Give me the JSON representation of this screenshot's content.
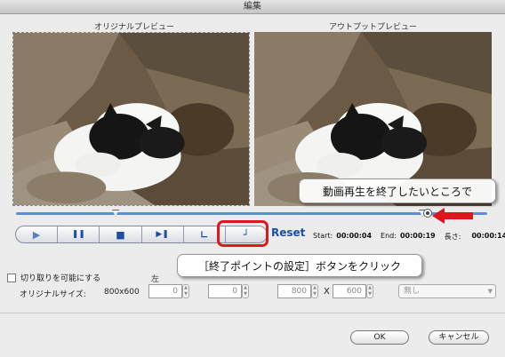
{
  "window": {
    "title": "編集"
  },
  "previews": {
    "original_label": "オリジナルプレビュー",
    "output_label": "アウトプットプレビュー"
  },
  "controls": {
    "buttons": [
      {
        "name": "play-button",
        "glyph": "▶"
      },
      {
        "name": "pause-button",
        "glyph": "❚❚"
      },
      {
        "name": "stop-button",
        "glyph": "■"
      },
      {
        "name": "next-frame-button",
        "glyph": "▶❚"
      },
      {
        "name": "set-start-point-button",
        "glyph": "∟"
      },
      {
        "name": "set-end-point-button",
        "glyph": "┘"
      }
    ],
    "reset_label": "Reset"
  },
  "times": {
    "start_label": "Start:",
    "start_value": "00:00:04",
    "end_label": "End:",
    "end_value": "00:00:19",
    "length_label": "長さ:",
    "length_value": "00:00:14"
  },
  "annotations": {
    "callout_playback_end": "動画再生を終了したいところで",
    "callout_set_end_point": "［終了ポイントの設定］ボタンをクリック",
    "highlight_color": "#e0161c"
  },
  "crop": {
    "enable_label": "切り取りを可能にする",
    "left_label": "左",
    "original_size_label": "オリジナルサイズ:",
    "original_size_value": "800x600",
    "field_left": "0",
    "field_top": "0",
    "field_width": "800",
    "x_label": "X",
    "field_height": "600",
    "aspect_select": "無し"
  },
  "footer": {
    "ok_label": "OK",
    "cancel_label": "キャンセル"
  }
}
